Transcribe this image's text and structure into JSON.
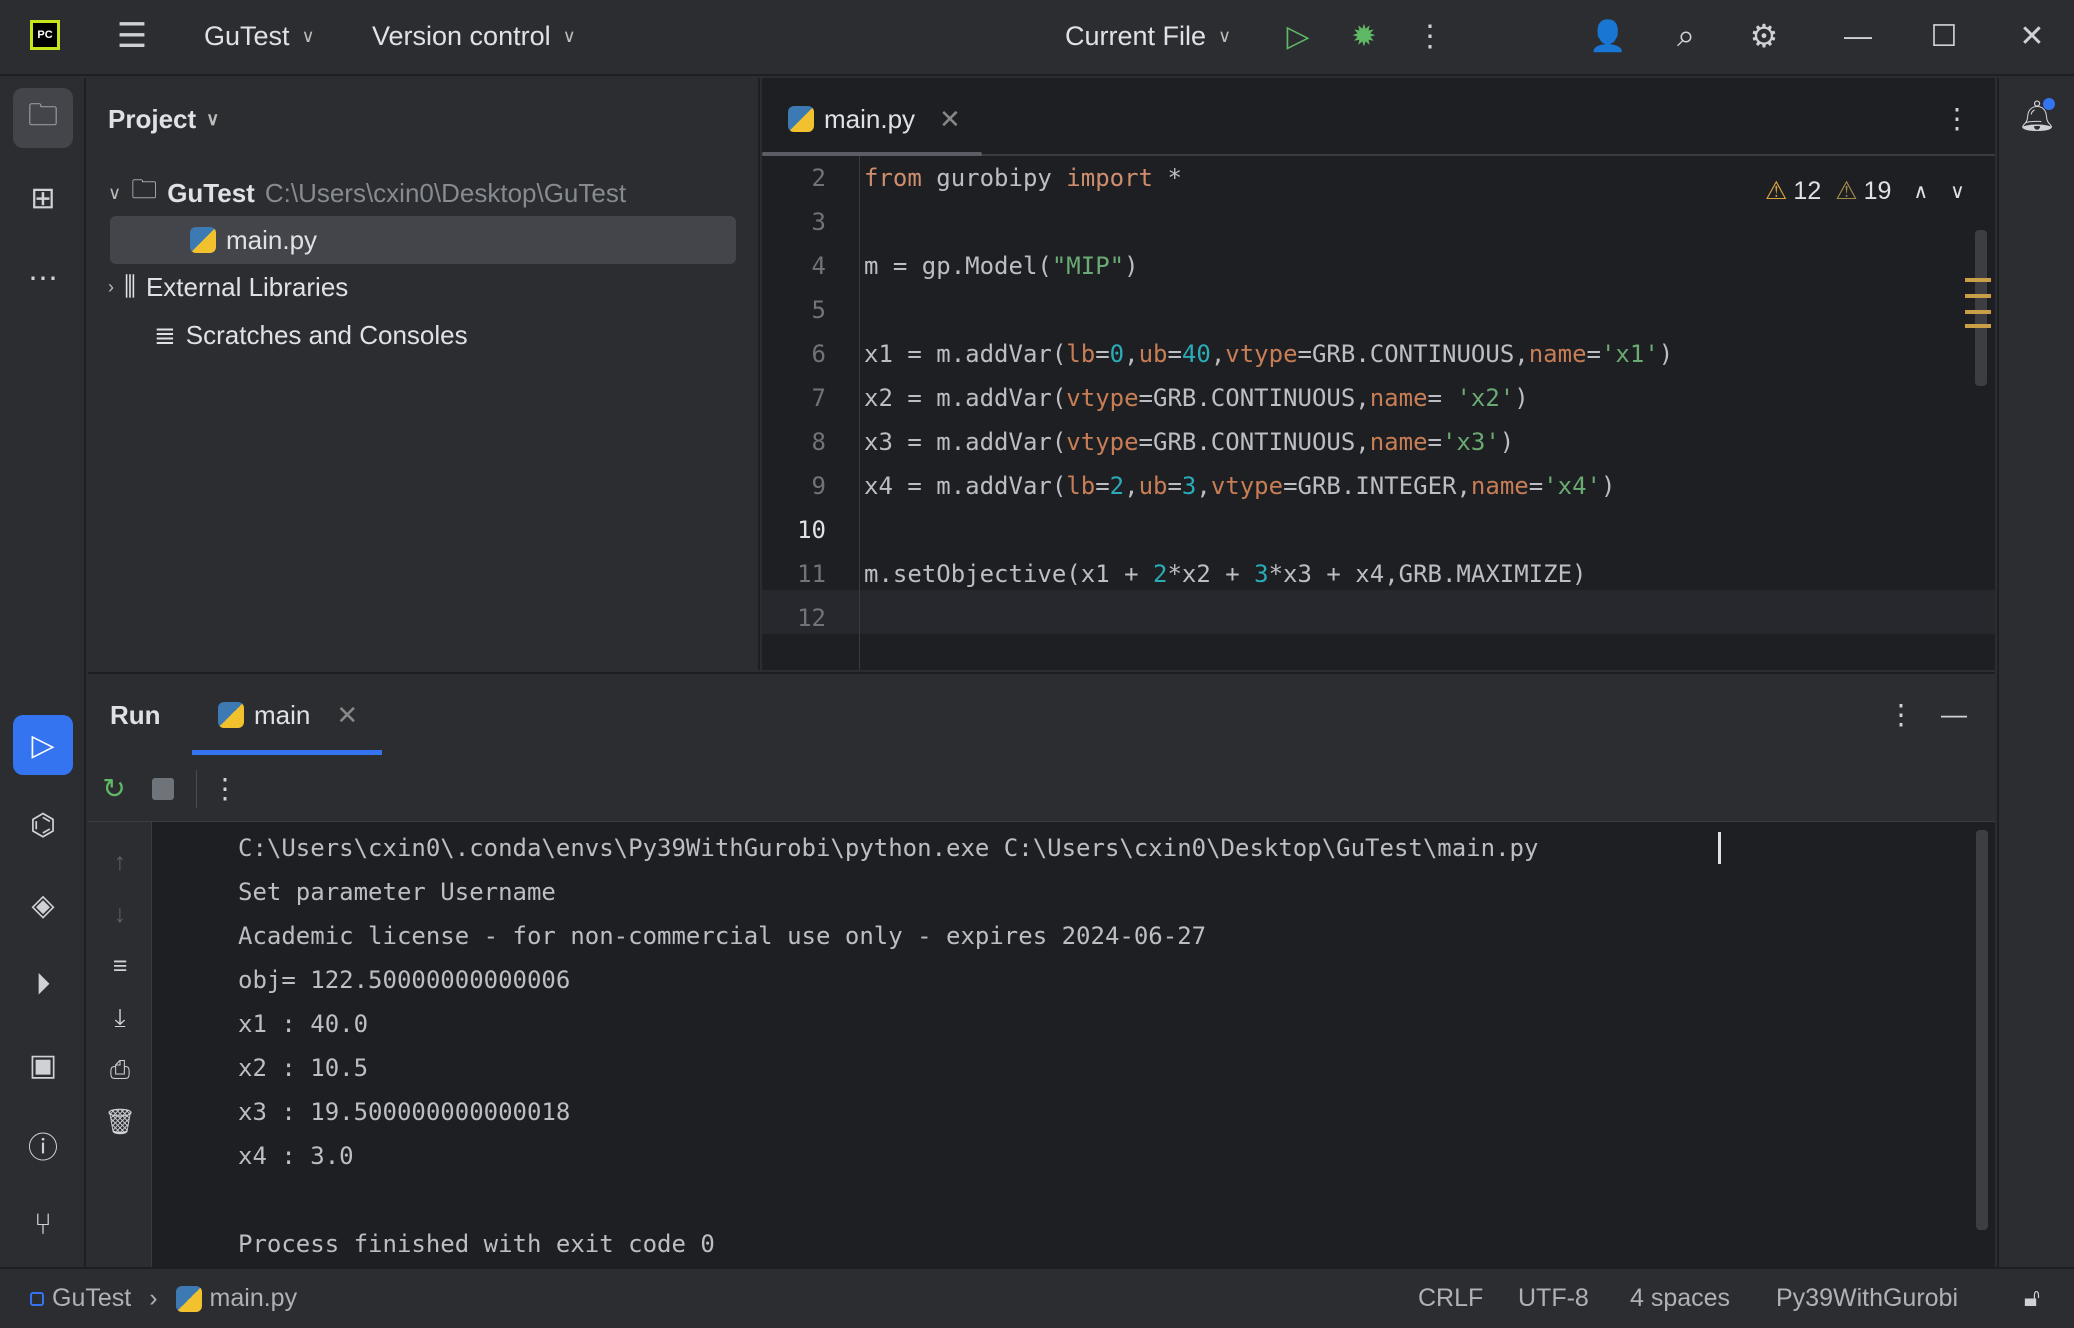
{
  "titlebar": {
    "project": "GuTest",
    "vcs": "Version control",
    "run_config": "Current File"
  },
  "project_panel": {
    "title": "Project",
    "root_name": "GuTest",
    "root_path": "C:\\Users\\cxin0\\Desktop\\GuTest",
    "file": "main.py",
    "external": "External Libraries",
    "scratches": "Scratches and Consoles"
  },
  "editor": {
    "tab": "main.py",
    "warnings_a": "12",
    "warnings_b": "19",
    "line_numbers": [
      "2",
      "3",
      "4",
      "5",
      "6",
      "7",
      "8",
      "9",
      "10",
      "11",
      "12"
    ]
  },
  "run": {
    "title": "Run",
    "tab": "main",
    "output": [
      "C:\\Users\\cxin0\\.conda\\envs\\Py39WithGurobi\\python.exe C:\\Users\\cxin0\\Desktop\\GuTest\\main.py",
      "Set parameter Username",
      "Academic license - for non-commercial use only - expires 2024-06-27",
      "obj= 122.50000000000006",
      "x1 : 40.0",
      "x2 : 10.5",
      "x3 : 19.500000000000018",
      "x4 : 3.0",
      "",
      "Process finished with exit code 0"
    ]
  },
  "status": {
    "project": "GuTest",
    "file": "main.py",
    "line_sep": "CRLF",
    "encoding": "UTF-8",
    "indent": "4 spaces",
    "interpreter": "Py39WithGurobi"
  },
  "colors": {
    "accent": "#3574f0",
    "keyword": "#cf8e6d",
    "string": "#6aab73",
    "number": "#2aacb8",
    "run_green": "#5fb865"
  }
}
